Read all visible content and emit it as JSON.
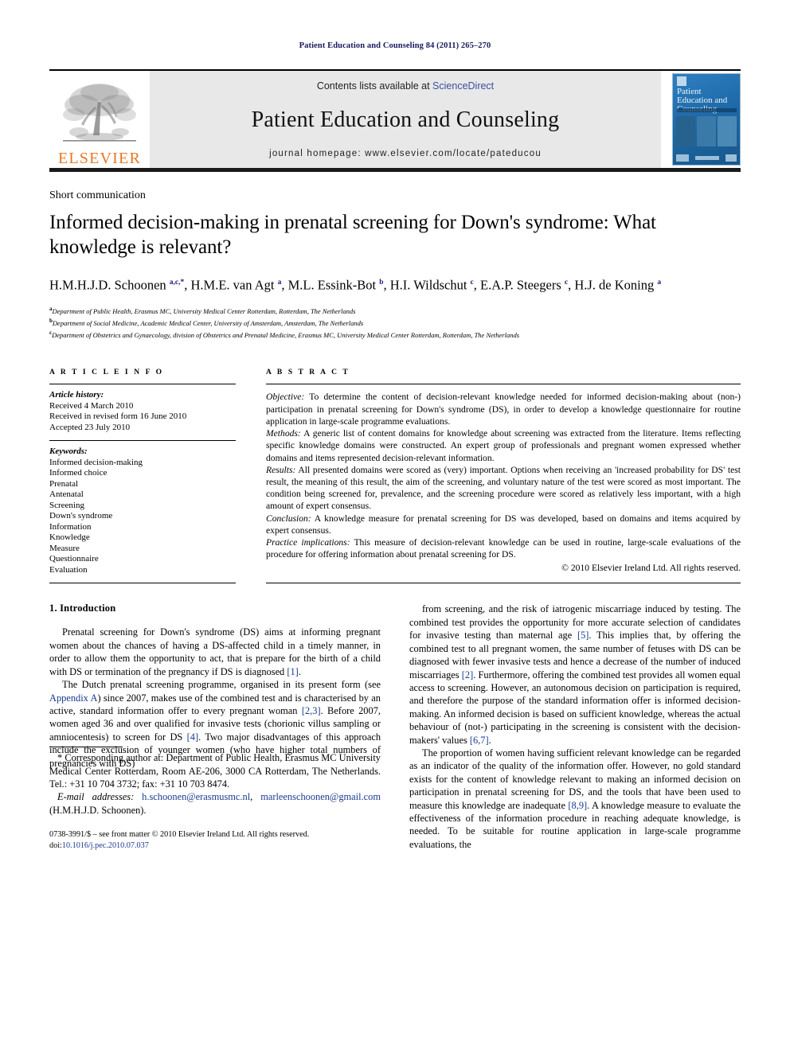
{
  "running_head": "Patient Education and Counseling 84 (2011) 265–270",
  "masthead": {
    "contents_prefix": "Contents lists available at ",
    "sciencedirect": "ScienceDirect",
    "journal_title": "Patient Education and Counseling",
    "homepage": "journal homepage: www.elsevier.com/locate/pateducou",
    "publisher": "ELSEVIER",
    "cover_title": "Patient Education and Counseling"
  },
  "article": {
    "type_label": "Short communication",
    "title": "Informed decision-making in prenatal screening for Down's syndrome: What knowledge is relevant?",
    "authors_html": "H.M.H.J.D. Schoonen <sup>a,c,*</sup>, H.M.E. van Agt <sup>a</sup>, M.L. Essink-Bot <sup>b</sup>, H.I. Wildschut <sup>c</sup>, E.A.P. Steegers <sup>c</sup>, H.J. de Koning <sup>a</sup>",
    "affiliations": [
      {
        "marker": "a",
        "text": "Department of Public Health, Erasmus MC, University Medical Center Rotterdam, Rotterdam, The Netherlands"
      },
      {
        "marker": "b",
        "text": "Department of Social Medicine, Academic Medical Center, University of Amsterdam, Amsterdam, The Netherlands"
      },
      {
        "marker": "c",
        "text": "Department of Obstetrics and Gynaecology, division of Obstetrics and Prenatal Medicine, Erasmus MC, University Medical Center Rotterdam, Rotterdam, The Netherlands"
      }
    ]
  },
  "article_info": {
    "header": "A R T I C L E   I N F O",
    "history_label": "Article history:",
    "history": [
      "Received 4 March 2010",
      "Received in revised form 16 June 2010",
      "Accepted 23 July 2010"
    ],
    "keywords_label": "Keywords:",
    "keywords": [
      "Informed decision-making",
      "Informed choice",
      "Prenatal",
      "Antenatal",
      "Screening",
      "Down's syndrome",
      "Information",
      "Knowledge",
      "Measure",
      "Questionnaire",
      "Evaluation"
    ]
  },
  "abstract": {
    "header": "A B S T R A C T",
    "sections": [
      {
        "label": "Objective:",
        "text": " To determine the content of decision-relevant knowledge needed for informed decision-making about (non-) participation in prenatal screening for Down's syndrome (DS), in order to develop a knowledge questionnaire for routine application in large-scale programme evaluations."
      },
      {
        "label": "Methods:",
        "text": " A generic list of content domains for knowledge about screening was extracted from the literature. Items reflecting specific knowledge domains were constructed. An expert group of professionals and pregnant women expressed whether domains and items represented decision-relevant information."
      },
      {
        "label": "Results:",
        "text": " All presented domains were scored as (very) important. Options when receiving an 'increased probability for DS' test result, the meaning of this result, the aim of the screening, and voluntary nature of the test were scored as most important. The condition being screened for, prevalence, and the screening procedure were scored as relatively less important, with a high amount of expert consensus."
      },
      {
        "label": "Conclusion:",
        "text": " A knowledge measure for prenatal screening for DS was developed, based on domains and items acquired by expert consensus."
      },
      {
        "label": "Practice implications:",
        "text": " This measure of decision-relevant knowledge can be used in routine, large-scale evaluations of the procedure for offering information about prenatal screening for DS."
      }
    ],
    "copyright": "© 2010 Elsevier Ireland Ltd. All rights reserved."
  },
  "body": {
    "section_heading": "1. Introduction",
    "left_paragraphs_html": [
      "Prenatal screening for Down's syndrome (DS) aims at informing pregnant women about the chances of having a DS-affected child in a timely manner, in order to allow them the opportunity to act, that is prepare for the birth of a child with DS or termination of the pregnancy if DS is diagnosed <span class=\"ref\">[1]</span>.",
      "The Dutch prenatal screening programme, organised in its present form (see <span class=\"link\">Appendix A</span>) since 2007, makes use of the combined test and is characterised by an active, standard information offer to every pregnant woman <span class=\"ref\">[2,3]</span>. Before 2007, women aged 36 and over qualified for invasive tests (chorionic villus sampling or amniocentesis) to screen for DS <span class=\"ref\">[4]</span>. Two major disadvantages of this approach include the exclusion of younger women (who have higher total numbers of pregnancies with DS)"
    ],
    "right_paragraphs_html": [
      "from screening, and the risk of iatrogenic miscarriage induced by testing. The combined test provides the opportunity for more accurate selection of candidates for invasive testing than maternal age <span class=\"ref\">[5]</span>. This implies that, by offering the combined test to all pregnant women, the same number of fetuses with DS can be diagnosed with fewer invasive tests and hence a decrease of the number of induced miscarriages <span class=\"ref\">[2]</span>. Furthermore, offering the combined test provides all women equal access to screening. However, an autonomous decision on participation is required, and therefore the purpose of the standard information offer is informed decision-making. An informed decision is based on sufficient knowledge, whereas the actual behaviour of (not-) participating in the screening is consistent with the decision-makers' values <span class=\"ref\">[6,7]</span>.",
      "The proportion of women having sufficient relevant knowledge can be regarded as an indicator of the quality of the information offer. However, no gold standard exists for the content of knowledge relevant to making an informed decision on participation in prenatal screening for DS, and the tools that have been used to measure this knowledge are inadequate <span class=\"ref\">[8,9]</span>. A knowledge measure to evaluate the effectiveness of the information procedure in reaching adequate knowledge, is needed. To be suitable for routine application in large-scale programme evaluations, the"
    ]
  },
  "footnotes": {
    "corresponding_html": "* Corresponding author at: Department of Public Health, Erasmus MC University Medical Center Rotterdam, Room AE-206, 3000 CA Rotterdam, The Netherlands. Tel.: +31 10 704 3732; fax: +31 10 703 8474.",
    "email_html": "<span class=\"em\">E-mail addresses:</span> <span class=\"link\">h.schoonen@erasmusmc.nl</span>, <span class=\"link\">marleenschoonen@gmail.com</span> (H.M.H.J.D. Schoonen).",
    "issn_html": "0738-3991/$ &ndash; see front matter © 2010 Elsevier Ireland Ltd. All rights reserved.<br>doi:<span class=\"doi\">10.1016/j.pec.2010.07.037</span>"
  }
}
